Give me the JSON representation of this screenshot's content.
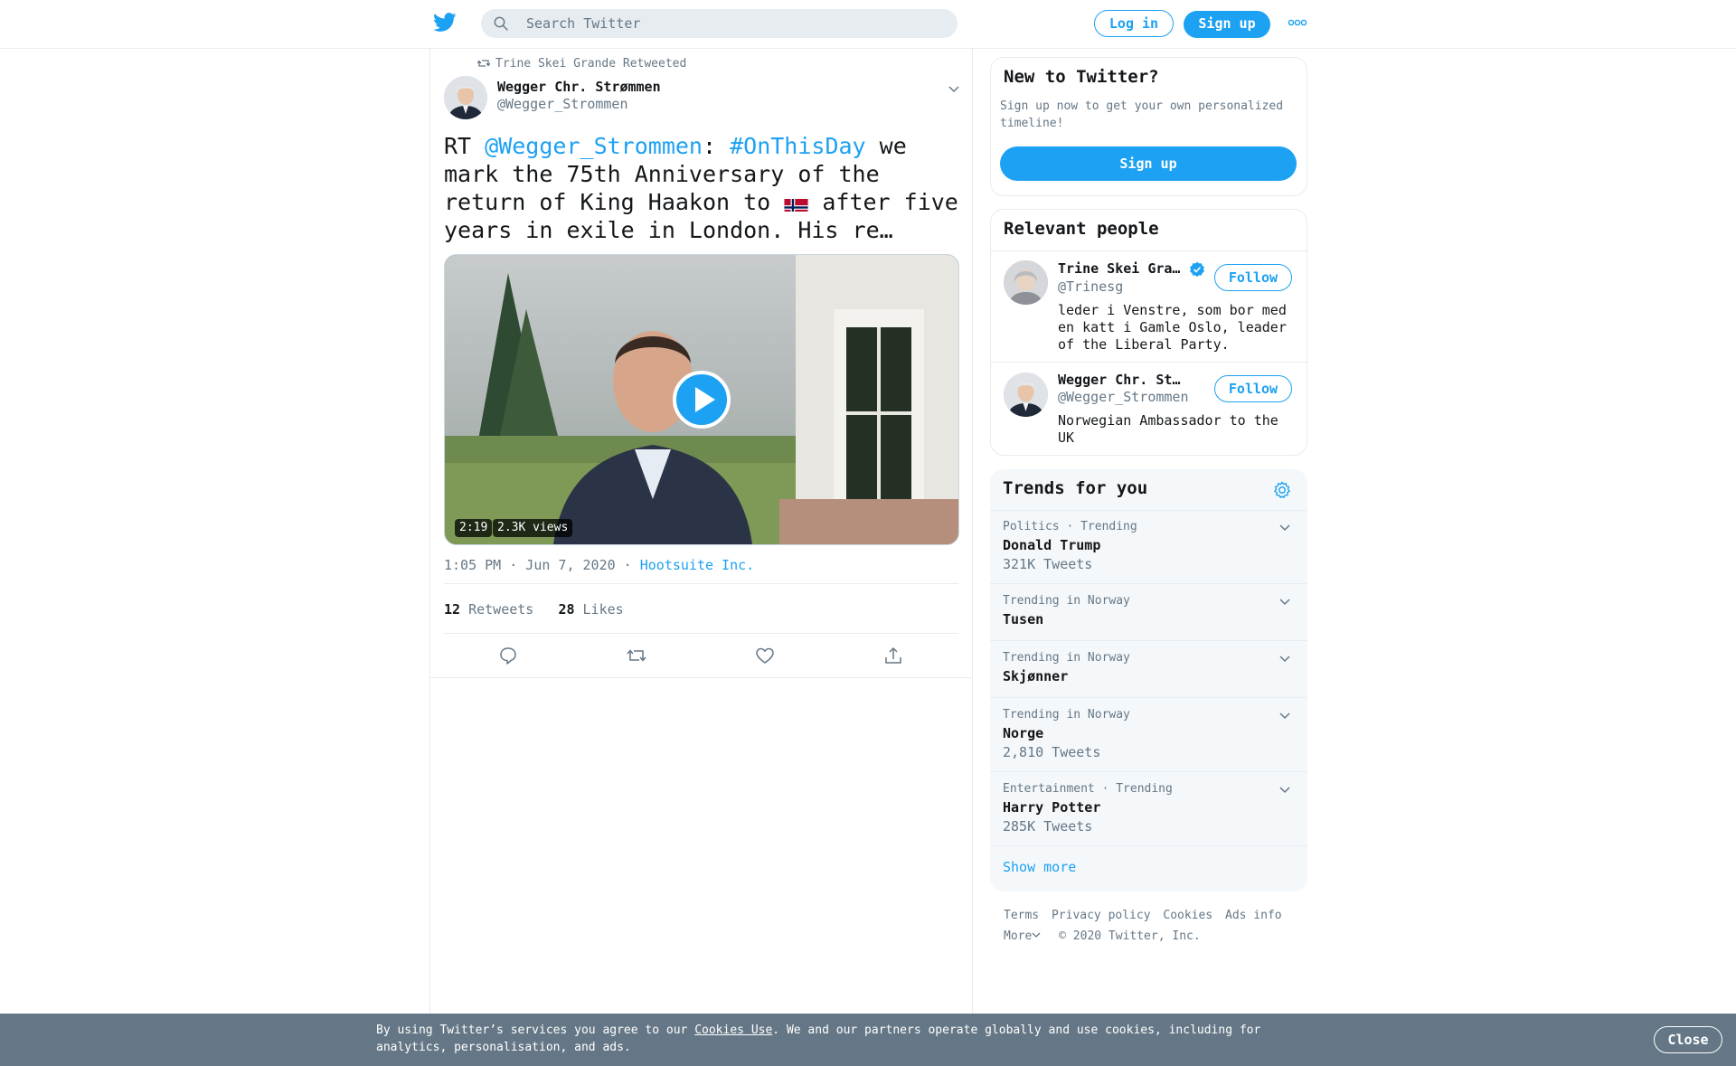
{
  "header": {
    "search_placeholder": "Search Twitter",
    "login_label": "Log in",
    "signup_label": "Sign up"
  },
  "tweet": {
    "retweeted_by": "Trine Skei Grande Retweeted",
    "author_name": "Wegger Chr. Strømmen",
    "author_handle": "@Wegger_Strommen",
    "text_prefix": "RT ",
    "mention": "@Wegger_Strommen",
    "colon": ": ",
    "hashtag": "#OnThisDay",
    "text_part1": " we mark the 75th Anniversary of the return of King Haakon to ",
    "text_part2": " after five years in exile in London. His re…",
    "video_duration": "2:19",
    "video_views": "2.3K views",
    "time": "1:05 PM · Jun 7, 2020 · ",
    "source": "Hootsuite Inc.",
    "retweets_count": "12",
    "retweets_label": "Retweets",
    "likes_count": "28",
    "likes_label": "Likes"
  },
  "new_to_twitter": {
    "title": "New to Twitter?",
    "text": "Sign up now to get your own personalized timeline!",
    "button": "Sign up"
  },
  "relevant_people": {
    "title": "Relevant people",
    "people": [
      {
        "name": "Trine Skei Gra…",
        "handle": "@Trinesg",
        "bio": "leder i Venstre, som bor med en katt i Gamle Oslo, leader of the Liberal Party.",
        "follow": "Follow",
        "verified": true
      },
      {
        "name": "Wegger Chr. Strøm…",
        "handle": "@Wegger_Strommen",
        "bio": "Norwegian Ambassador to the UK",
        "follow": "Follow",
        "verified": false
      }
    ]
  },
  "trends": {
    "title": "Trends for you",
    "items": [
      {
        "context": "Politics · Trending",
        "name": "Donald Trump",
        "count": "321K Tweets"
      },
      {
        "context": "Trending in Norway",
        "name": "Tusen",
        "count": ""
      },
      {
        "context": "Trending in Norway",
        "name": "Skjønner",
        "count": ""
      },
      {
        "context": "Trending in Norway",
        "name": "Norge",
        "count": "2,810 Tweets"
      },
      {
        "context": "Entertainment · Trending",
        "name": "Harry Potter",
        "count": "285K Tweets"
      }
    ],
    "show_more": "Show more"
  },
  "footer": {
    "links": [
      "Terms",
      "Privacy policy",
      "Cookies",
      "Ads info"
    ],
    "more": "More",
    "copyright": "© 2020 Twitter, Inc."
  },
  "cookie_bar": {
    "text_before": "By using Twitter’s services you agree to our ",
    "link": "Cookies Use",
    "text_after": ". We and our partners operate globally and use cookies, including for analytics, personalisation, and ads.",
    "close": "Close"
  },
  "colors": {
    "brand": "#1da1f2",
    "text": "#14171a",
    "secondary": "#657786",
    "border": "#e6ecf0"
  }
}
